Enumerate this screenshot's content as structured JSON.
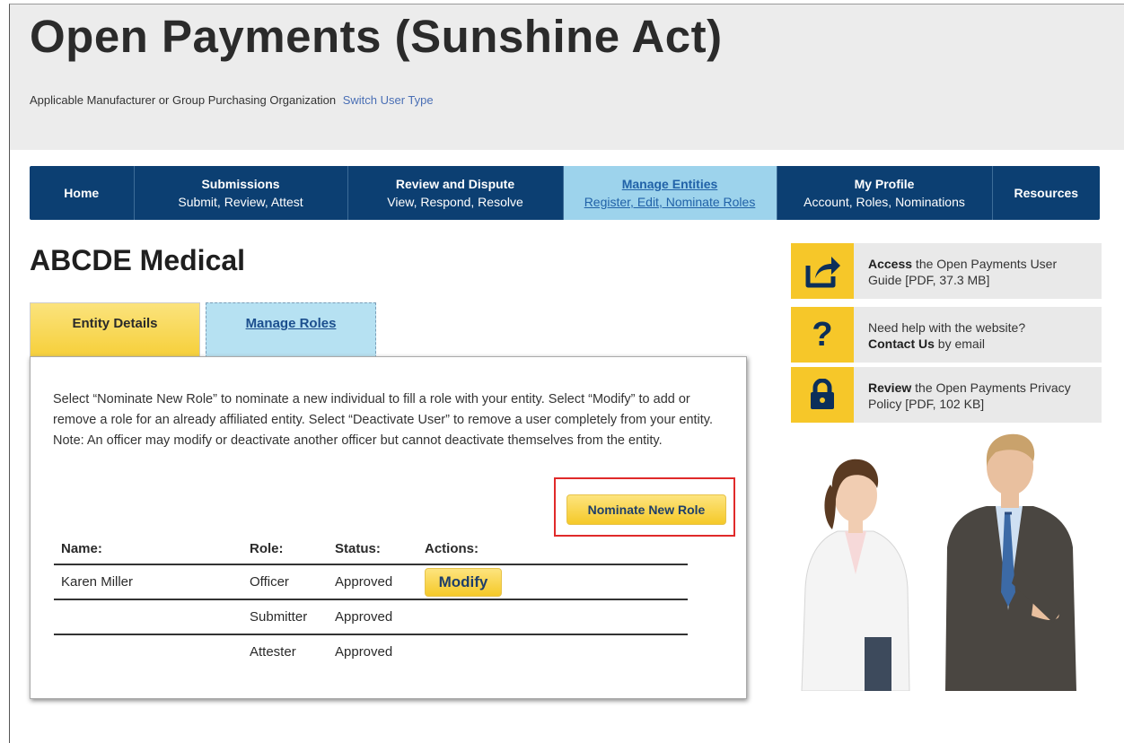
{
  "header": {
    "title": "Open Payments (Sunshine Act)",
    "subtitle": "Applicable Manufacturer or Group Purchasing Organization",
    "switch_link": "Switch User Type"
  },
  "nav": {
    "items": [
      {
        "title": "Home",
        "sub": ""
      },
      {
        "title": "Submissions",
        "sub": "Submit, Review, Attest"
      },
      {
        "title": "Review and Dispute",
        "sub": "View, Respond, Resolve"
      },
      {
        "title": "Manage Entities",
        "sub": "Register, Edit, Nominate Roles"
      },
      {
        "title": "My Profile",
        "sub": "Account, Roles, Nominations"
      },
      {
        "title": "Resources",
        "sub": ""
      }
    ],
    "active_index": 3
  },
  "page": {
    "title": "ABCDE Medical",
    "tabs": [
      "Entity Details",
      "Manage Roles"
    ],
    "instructions": "Select “Nominate New Role” to nominate a new individual to fill a role with your entity. Select “Modify” to add or remove a role for an already affiliated entity. Select “Deactivate User” to remove a user completely from your entity. Note: An officer may modify or deactivate another officer but cannot deactivate themselves from the entity.",
    "nominate_button": "Nominate New Role",
    "table": {
      "headers": [
        "Name:",
        "Role:",
        "Status:",
        "Actions:"
      ],
      "rows": [
        {
          "name": "Karen Miller",
          "role": "Officer",
          "status": "Approved",
          "action": "Modify"
        },
        {
          "name": "",
          "role": "Submitter",
          "status": "Approved",
          "action": ""
        },
        {
          "name": "",
          "role": "Attester",
          "status": "Approved",
          "action": ""
        }
      ]
    }
  },
  "sidebar": {
    "guide": {
      "bold": "Access",
      "text": " the Open Payments User Guide [PDF, 37.3 MB]"
    },
    "help": {
      "text": "Need help with the website?",
      "bold": "Contact Us",
      "text2": " by email"
    },
    "privacy": {
      "bold": "Review",
      "text": " the Open Payments Privacy Policy [PDF, 102 KB]"
    }
  },
  "colors": {
    "nav_bg": "#0c3f72",
    "nav_active": "#9dd3ec",
    "accent_yellow": "#f6c729",
    "highlight_red": "#e02a2a"
  }
}
